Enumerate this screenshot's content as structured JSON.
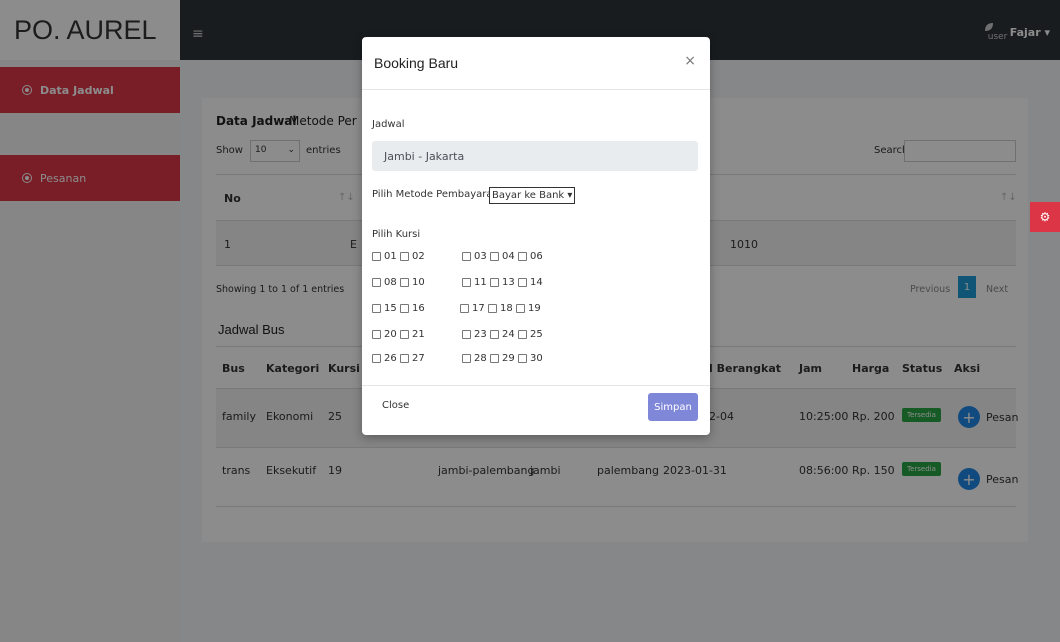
{
  "brand": "PO. AUREL",
  "sidebar": {
    "items": [
      {
        "label": "Data Jadwal"
      },
      {
        "label": "Pesanan"
      }
    ]
  },
  "topbar": {
    "user_avatar_alt": "user",
    "user_name": "Fajar ▾"
  },
  "data_jadwal": {
    "title_a": "Data Jadwal",
    "title_b": "Metode Per",
    "show": "Show",
    "entries_value": "10",
    "entries": "entries",
    "search": "Search:",
    "columns": [
      "No"
    ],
    "row": {
      "no": "1",
      "hidden": "E",
      "trailing": "1010"
    },
    "info": "Showing 1 to 1 of 1 entries",
    "pagination": {
      "previous": "Previous",
      "current": "1",
      "next": "Next"
    }
  },
  "jadwal_bus": {
    "title": "Jadwal Bus",
    "columns": [
      "Bus",
      "Kategori",
      "Kursi T",
      "l Berangkat",
      "Jam",
      "Harga",
      "Status",
      "Aksi"
    ],
    "rows": [
      {
        "bus": "family",
        "kategori": "Ekonomi",
        "kursi": "25",
        "tanggal": "2-04",
        "jam": "10:25:00",
        "harga": "Rp. 200",
        "status": "Tersedia",
        "aksi": "Pesan"
      },
      {
        "bus": "trans",
        "kategori": "Eksekutif",
        "kursi": "19",
        "rute": "jambi-palembang",
        "asal": "jambi",
        "tujuan": "palembang",
        "tanggal": "2023-01-31",
        "jam": "08:56:00",
        "harga": "Rp. 150",
        "status": "Tersedia",
        "aksi": "Pesan"
      }
    ]
  },
  "modal": {
    "title": "Booking Baru",
    "close_icon": "×",
    "jadwal_label": "Jadwal",
    "jadwal_value": "Jambi - Jakarta",
    "metode_label": "Pilih Metode Pembayaran",
    "metode_value": "Bayar ke Bank ▾",
    "kursi_label": "Pilih Kursi",
    "seat_rows": [
      [
        "01",
        "02",
        "03",
        "04",
        "06"
      ],
      [
        "08",
        "10",
        "11",
        "13",
        "14"
      ],
      [
        "15",
        "16",
        "17",
        "18",
        "19"
      ],
      [
        "20",
        "21",
        "23",
        "24",
        "25"
      ],
      [
        "26",
        "27",
        "28",
        "29",
        "30"
      ]
    ],
    "close_label": "Close",
    "submit_label": "Simpan"
  },
  "colors": {
    "accent_red": "#dc3545",
    "topbar": "#2d3338",
    "primary_blue": "#1e88e5",
    "success": "#28a745",
    "simpan": "#7f87d8"
  },
  "icons": {
    "menu": "hamburger-icon",
    "settings": "gear-icon",
    "add": "plus-icon",
    "radio": "circle-dot-icon"
  }
}
